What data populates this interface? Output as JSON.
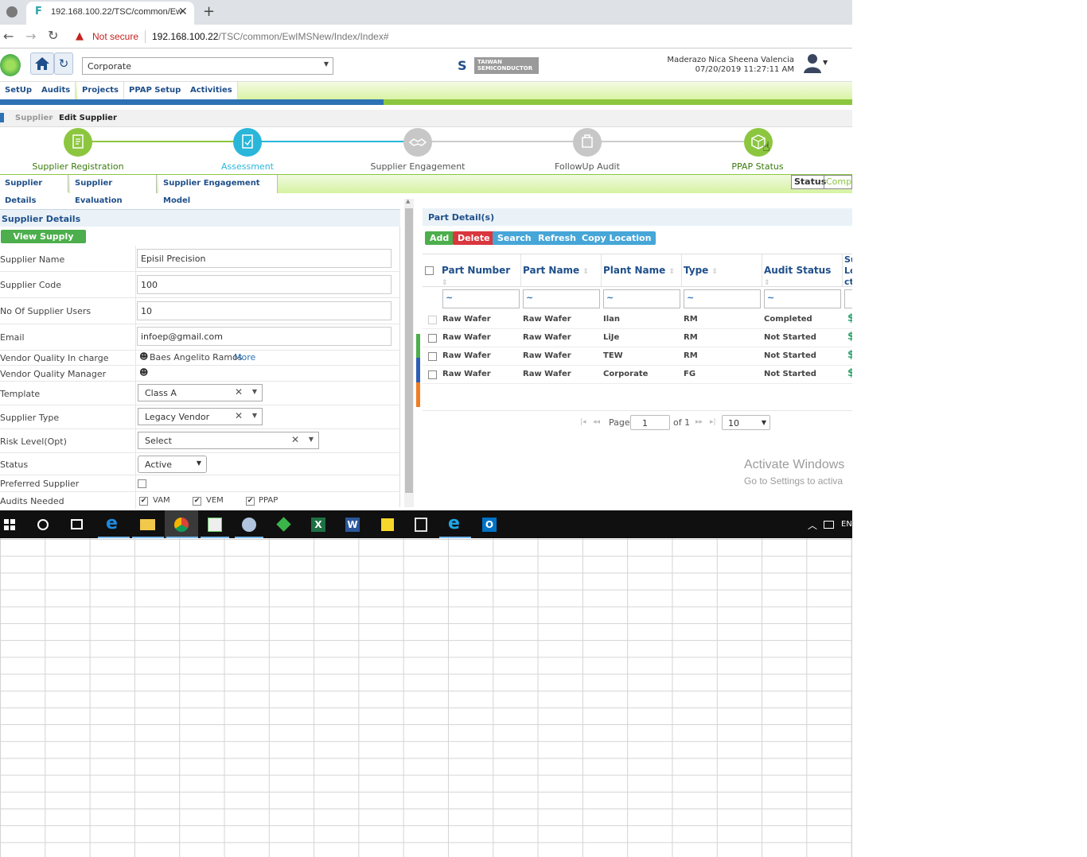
{
  "browser": {
    "tab_title": "192.168.100.22/TSC/common/Ew",
    "security": "Not secure",
    "url_host": "192.168.100.22",
    "url_path": "/TSC/common/EwIMSNew/Index/Index#"
  },
  "header": {
    "site_select": "Corporate",
    "logo_line1": "TAIWAN",
    "logo_line2": "SEMICONDUCTOR",
    "user_name": "Maderazo Nica Sheena Valencia",
    "datetime": "07/20/2019 11:27:11 AM"
  },
  "menu": [
    "SetUp",
    "Audits",
    "Projects",
    "PPAP Setup",
    "Activities"
  ],
  "breadcrumb": {
    "parent": "Supplier",
    "current": "Edit Supplier"
  },
  "steps": [
    {
      "label": "Supplier Registration"
    },
    {
      "label": "Assessment"
    },
    {
      "label": "Supplier Engagement"
    },
    {
      "label": "FollowUp Audit"
    },
    {
      "label": "PPAP Status"
    }
  ],
  "subtabs": [
    "Supplier Details",
    "Supplier Evaluation",
    "Supplier Engagement Model"
  ],
  "status_box": {
    "label": "Status",
    "value": "Comple"
  },
  "supplier": {
    "title": "Supplier Details",
    "view_chain": "View Supply Chain",
    "fields": {
      "name_label": "Supplier Name",
      "name": "Episil Precision",
      "code_label": "Supplier Code",
      "code": "100",
      "users_label": "No Of Supplier Users",
      "users": "10",
      "email_label": "Email",
      "email": "infoep@gmail.com",
      "vqi_label": "Vendor Quality In charge",
      "vqi": "Baes Angelito Ramos",
      "vqi_more": "More",
      "vqm_label": "Vendor Quality Manager",
      "template_label": "Template",
      "template": "Class A",
      "type_label": "Supplier Type",
      "type": "Legacy Vendor",
      "risk_label": "Risk Level(Opt)",
      "risk": "Select",
      "status_label": "Status",
      "status": "Active",
      "preferred_label": "Preferred Supplier",
      "audits_label": "Audits Needed",
      "audits": [
        "VAM",
        "VEM",
        "PPAP"
      ]
    }
  },
  "parts": {
    "title": "Part Detail(s)",
    "buttons": {
      "add": "Add",
      "delete": "Delete",
      "search": "Search",
      "refresh": "Refresh",
      "copy": "Copy Location"
    },
    "columns": [
      "Part Number",
      "Part Name",
      "Plant Name",
      "Type",
      "Audit Status",
      "Su",
      "Lo",
      "ct"
    ],
    "filter_symbol": "~",
    "rows": [
      [
        "Raw Wafer",
        "Raw Wafer",
        "Ilan",
        "RM",
        "Completed"
      ],
      [
        "Raw Wafer",
        "Raw Wafer",
        "LiJe",
        "RM",
        "Not Started"
      ],
      [
        "Raw Wafer",
        "Raw Wafer",
        "TEW",
        "RM",
        "Not Started"
      ],
      [
        "Raw Wafer",
        "Raw Wafer",
        "Corporate",
        "FG",
        "Not Started"
      ]
    ],
    "pager": {
      "page_label": "Page",
      "page": "1",
      "of": "of 1",
      "size": "10"
    }
  },
  "watermark": {
    "line1": "Activate Windows",
    "line2": "Go to Settings to activa"
  },
  "taskbar": {
    "lang": "EN"
  },
  "colors": {
    "accent_green": "#8cc63f",
    "accent_blue": "#2d72b4",
    "step_teal": "#29b6d9"
  }
}
